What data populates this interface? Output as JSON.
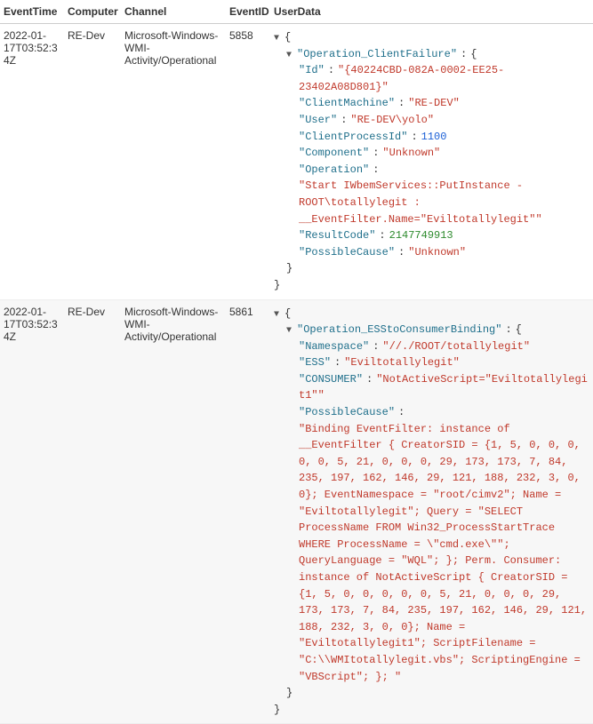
{
  "columns": [
    "EventTime",
    "Computer",
    "Channel",
    "EventID",
    "UserData"
  ],
  "rows": [
    {
      "EventTime": "2022-01-17T03:52:34Z",
      "Computer": "RE-Dev",
      "Channel": "Microsoft-Windows-WMI-Activity/Operational",
      "EventID": "5858",
      "UserData": {
        "root_key": "Operation_ClientFailure",
        "fields": [
          {
            "k": "Id",
            "v": "{40224CBD-082A-0002-EE25-23402A08D801}",
            "t": "str"
          },
          {
            "k": "ClientMachine",
            "v": "RE-DEV",
            "t": "str"
          },
          {
            "k": "User",
            "v": "RE-DEV\\yolo",
            "t": "str"
          },
          {
            "k": "ClientProcessId",
            "v": "1100",
            "t": "num-blue"
          },
          {
            "k": "Component",
            "v": "Unknown",
            "t": "str"
          },
          {
            "k": "Operation",
            "v": "Start IWbemServices::PutInstance - ROOT\\totallylegit : __EventFilter.Name=\"Eviltotallylegit\"",
            "t": "str",
            "multiline": true
          },
          {
            "k": "ResultCode",
            "v": "2147749913",
            "t": "num-green"
          },
          {
            "k": "PossibleCause",
            "v": "Unknown",
            "t": "str"
          }
        ]
      }
    },
    {
      "EventTime": "2022-01-17T03:52:34Z",
      "Computer": "RE-Dev",
      "Channel": "Microsoft-Windows-WMI-Activity/Operational",
      "EventID": "5861",
      "UserData": {
        "root_key": "Operation_ESStoConsumerBinding",
        "fields": [
          {
            "k": "Namespace",
            "v": "//./ROOT/totallylegit",
            "t": "str"
          },
          {
            "k": "ESS",
            "v": "Eviltotallylegit",
            "t": "str"
          },
          {
            "k": "CONSUMER",
            "v": "NotActiveScript=\"Eviltotallylegit1\"",
            "t": "str"
          },
          {
            "k": "PossibleCause",
            "v": "Binding EventFilter: instance of __EventFilter { CreatorSID = {1, 5, 0, 0, 0, 0, 0, 5, 21, 0, 0, 0, 29, 173, 173, 7, 84, 235, 197, 162, 146, 29, 121, 188, 232, 3, 0, 0}; EventNamespace = \"root/cimv2\"; Name = \"Eviltotallylegit\"; Query = \"SELECT ProcessName FROM Win32_ProcessStartTrace WHERE ProcessName = \\\"cmd.exe\\\"\"; QueryLanguage = \"WQL\"; }; Perm. Consumer: instance of NotActiveScript { CreatorSID = {1, 5, 0, 0, 0, 0, 0, 5, 21, 0, 0, 0, 29, 173, 173, 7, 84, 235, 197, 162, 146, 29, 121, 188, 232, 3, 0, 0}; Name = \"Eviltotallylegit1\"; ScriptFilename = \"C:\\\\WMItotallylegit.vbs\"; ScriptingEngine = \"VBScript\"; }; ",
            "t": "str",
            "multiline": true
          }
        ]
      }
    }
  ]
}
